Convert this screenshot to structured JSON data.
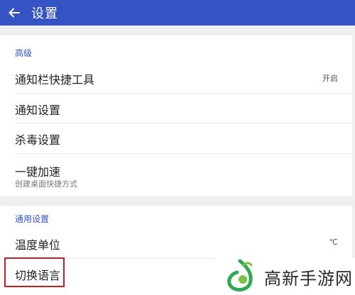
{
  "header": {
    "title": "设置",
    "bg_color": "#3553c3"
  },
  "advanced": {
    "heading": "高级",
    "items": [
      {
        "label": "通知栏快捷工具",
        "value": "开启"
      },
      {
        "label": "通知设置"
      },
      {
        "label": "杀毒设置"
      },
      {
        "label": "一键加速",
        "sub": "创建桌面快捷方式"
      }
    ]
  },
  "general": {
    "heading": "通用设置",
    "items": [
      {
        "label": "温度单位",
        "value": "℃"
      },
      {
        "label": "切换语言"
      }
    ]
  },
  "watermark": {
    "text": "高新手游网",
    "accent_color": "#2fa84f"
  },
  "highlight_color": "#cc1d1d"
}
